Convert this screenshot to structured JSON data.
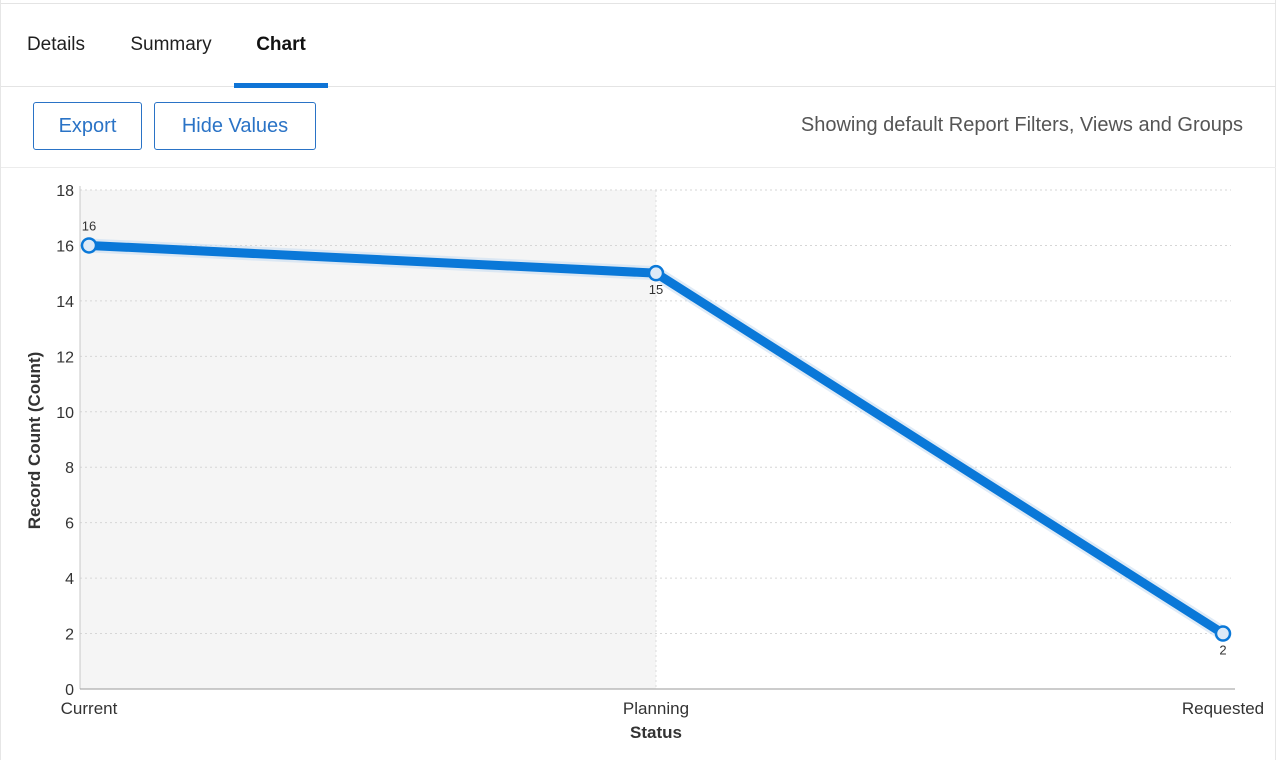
{
  "tabs": [
    {
      "label": "Details"
    },
    {
      "label": "Summary"
    },
    {
      "label": "Chart"
    }
  ],
  "toolbar": {
    "export_label": "Export",
    "hide_values_label": "Hide Values",
    "filter_note": "Showing default Report Filters, Views and Groups"
  },
  "colors": {
    "accent": "#0f74d6",
    "line": "#0a78d8",
    "button_border": "#2a73c6"
  },
  "chart_data": {
    "type": "line",
    "categories": [
      "Current",
      "Planning",
      "Requested"
    ],
    "series": [
      {
        "values": [
          16,
          15,
          2
        ]
      }
    ],
    "data_labels": [
      "16",
      "15",
      "2"
    ],
    "xlabel": "Status",
    "ylabel": "Record Count (Count)",
    "ylim": [
      0,
      18
    ],
    "yticks": [
      0,
      2,
      4,
      6,
      8,
      10,
      12,
      14,
      16,
      18
    ],
    "ytick_labels": [
      "0",
      "2",
      "4",
      "6",
      "8",
      "10",
      "12",
      "14",
      "16",
      "18"
    ],
    "grid": true,
    "legend": "none"
  }
}
